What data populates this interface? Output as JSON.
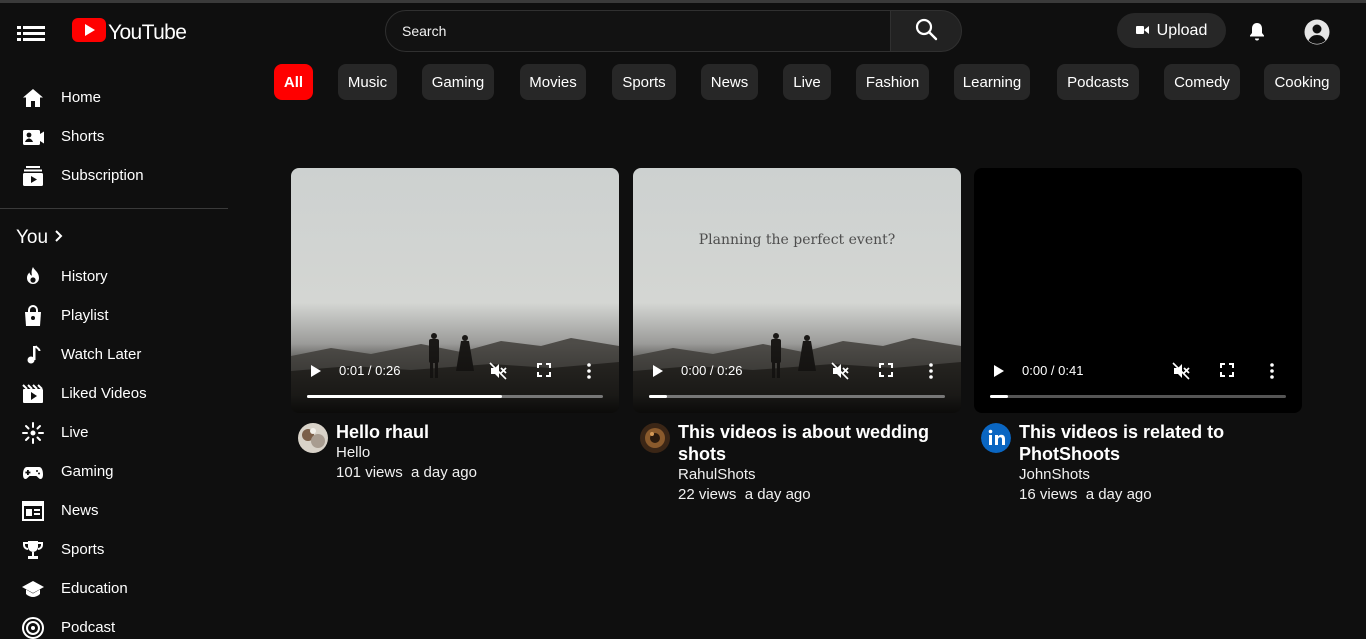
{
  "app": {
    "name": "YouTube",
    "brand_color": "#ff0000",
    "background": "#0f0f0f"
  },
  "header": {
    "search_placeholder": "Search",
    "upload_label": "Upload",
    "icons": [
      "menu-icon",
      "youtube-logo-icon",
      "search-icon",
      "camera-icon",
      "bell-icon",
      "account-icon"
    ]
  },
  "sidebar": {
    "main": [
      {
        "label": "Home",
        "icon": "home-icon"
      },
      {
        "label": "Shorts",
        "icon": "shorts-icon"
      },
      {
        "label": "Subscription",
        "icon": "subscriptions-icon"
      }
    ],
    "you_label": "You",
    "you_items": [
      {
        "label": "History",
        "icon": "history-icon"
      },
      {
        "label": "Playlist",
        "icon": "playlist-icon"
      },
      {
        "label": "Watch Later",
        "icon": "music-note-icon"
      },
      {
        "label": "Liked Videos",
        "icon": "movies-icon"
      },
      {
        "label": "Live",
        "icon": "live-icon"
      },
      {
        "label": "Gaming",
        "icon": "gamepad-icon"
      },
      {
        "label": "News",
        "icon": "news-icon"
      },
      {
        "label": "Sports",
        "icon": "trophy-icon"
      },
      {
        "label": "Education",
        "icon": "education-icon"
      },
      {
        "label": "Podcast",
        "icon": "podcast-icon"
      }
    ]
  },
  "chips": [
    "All",
    "Music",
    "Gaming",
    "Movies",
    "Sports",
    "News",
    "Live",
    "Fashion",
    "Learning",
    "Podcasts",
    "Comedy",
    "Cooking"
  ],
  "active_chip": "All",
  "videos": [
    {
      "title": "Hello rhaul",
      "channel": "Hello",
      "views": "101 views",
      "age": "a day ago",
      "time": "0:01 / 0:26",
      "progress": 0.66,
      "overlay_text": "",
      "avatar": "channel-avatar-photo"
    },
    {
      "title": "This videos is about wedding shots",
      "channel": "RahulShots",
      "views": "22 views",
      "age": "a day ago",
      "time": "0:00 / 0:26",
      "progress": 0.0,
      "overlay_text": "Planning the perfect event?",
      "avatar": "channel-avatar-photo"
    },
    {
      "title": "This videos is related to PhotShoots",
      "channel": "JohnShots",
      "views": "16 views",
      "age": "a day ago",
      "time": "0:00 / 0:41",
      "progress": 0.0,
      "overlay_text": "",
      "avatar": "linkedin-icon"
    }
  ]
}
